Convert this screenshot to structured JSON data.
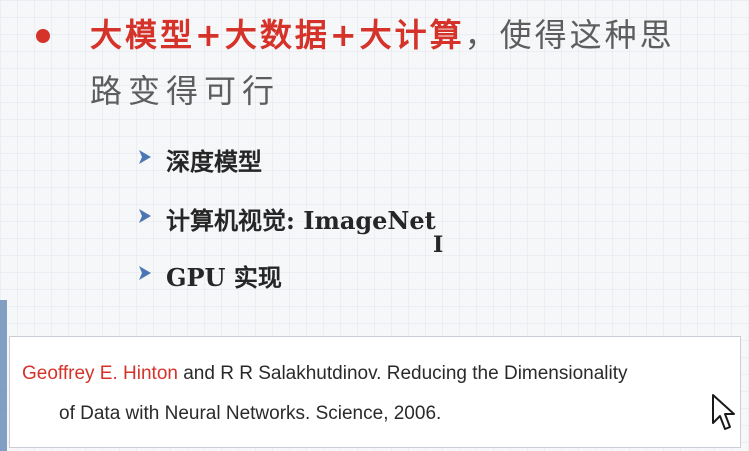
{
  "slide": {
    "bullet": {
      "highlight": "大模型+大数据+大计算",
      "rest": "，使得这种思",
      "continuation": "路变得可行"
    },
    "sub_items": [
      {
        "icon": "arrow-right-icon",
        "label": "深度模型"
      },
      {
        "icon": "arrow-right-icon",
        "label": "计算机视觉: ImageNet"
      },
      {
        "icon": "arrow-right-icon",
        "label": "GPU 实现"
      }
    ],
    "reference": {
      "author": "Geoffrey E. Hinton",
      "line1_rest": " and R R Salakhutdinov. Reducing the Dimensionality",
      "line2": "of  Data with Neural Networks. Science, 2006."
    }
  },
  "colors": {
    "accent_red": "#d5332a",
    "arrow_blue": "#4a77b4",
    "text_gray": "#5d5d5d"
  }
}
